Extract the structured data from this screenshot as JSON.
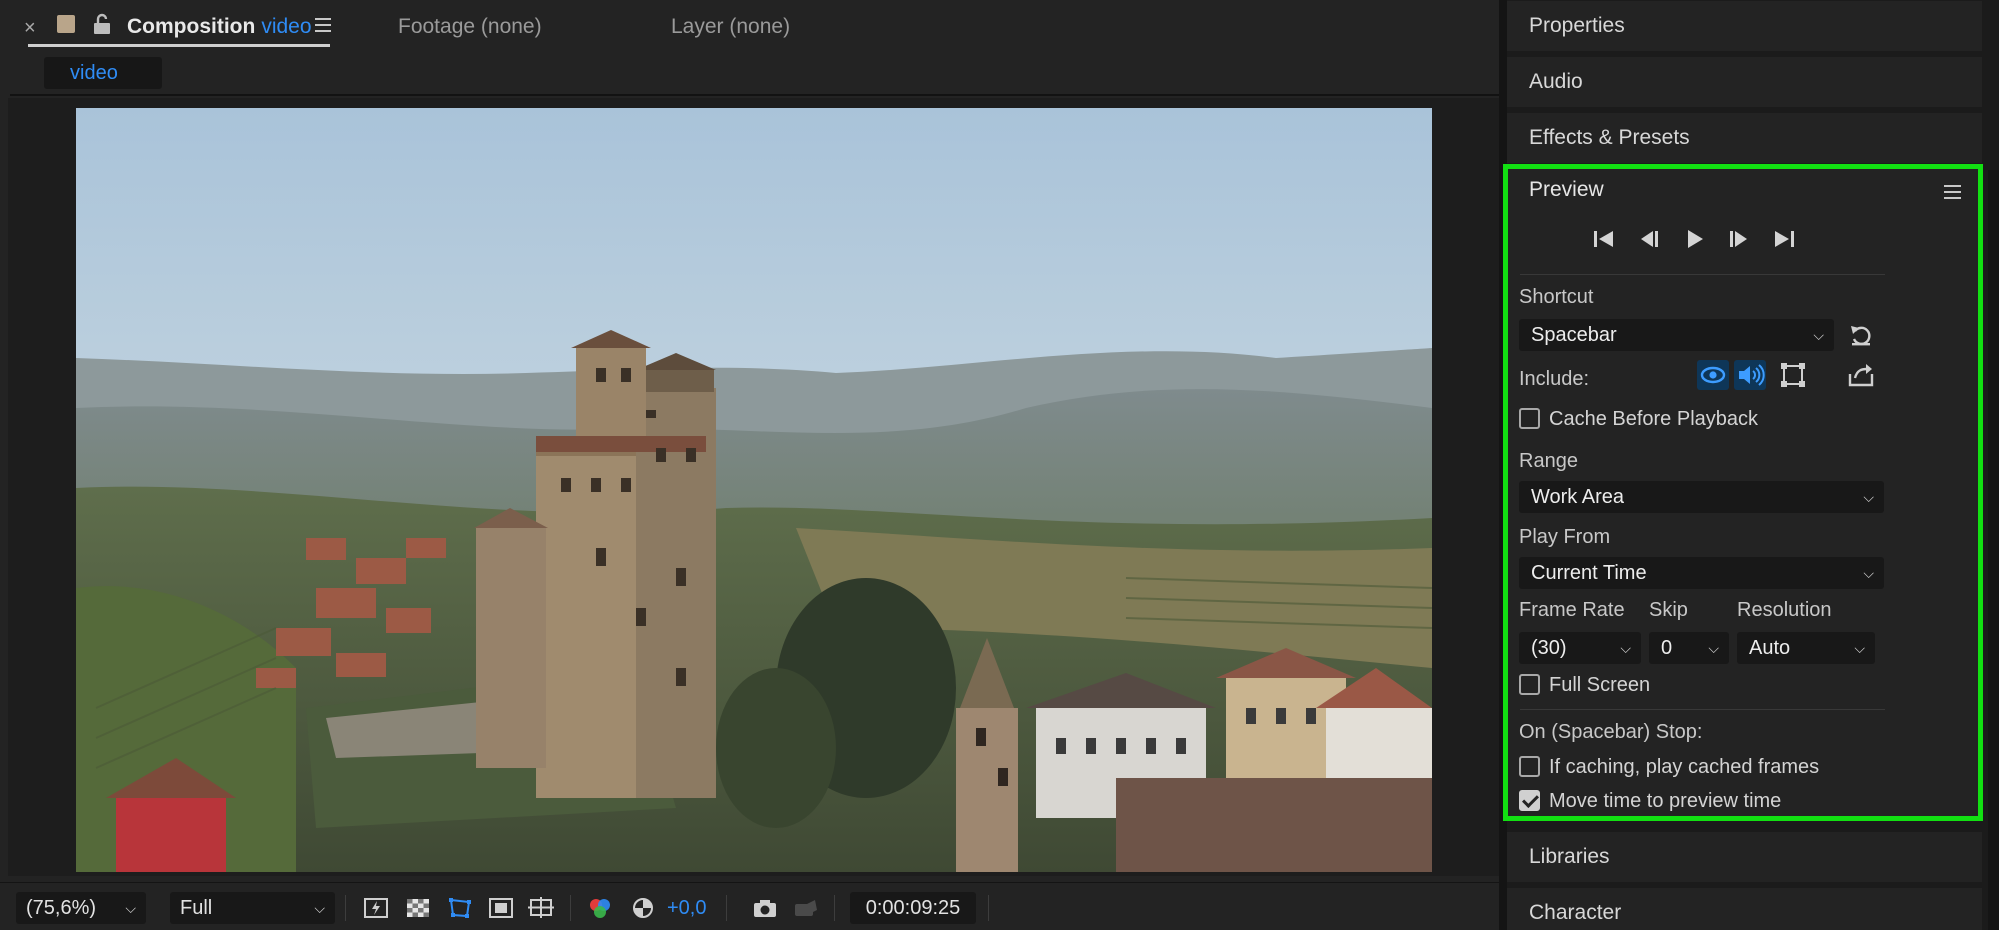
{
  "composition_panel": {
    "tabs": {
      "close_glyph": "×",
      "composition_label": "Composition",
      "composition_name": "video",
      "footage_label": "Footage (none)",
      "layer_label": "Layer (none)"
    },
    "subtab": "video",
    "footer": {
      "zoom": "(75,6%)",
      "resolution": "Full",
      "exposure": "+0,0",
      "timecode": "0:00:09:25",
      "icons": [
        "fast-previews-icon",
        "transparency-grid-icon",
        "mask-path-visibility-icon",
        "region-of-interest-icon",
        "safe-margins-icon",
        "channels-icon",
        "reset-exposure-icon",
        "snapshot-icon",
        "show-snapshot-icon"
      ]
    }
  },
  "right_panels": {
    "properties": "Properties",
    "audio": "Audio",
    "effects_presets": "Effects & Presets",
    "libraries": "Libraries",
    "character": "Character"
  },
  "preview": {
    "title": "Preview",
    "transport": [
      "first-frame-icon",
      "previous-frame-icon",
      "play-icon",
      "next-frame-icon",
      "last-frame-icon"
    ],
    "shortcut_label": "Shortcut",
    "shortcut_value": "Spacebar",
    "include_label": "Include:",
    "include_icons": [
      "video-eye-icon",
      "audio-speaker-icon",
      "overlays-icon",
      "export-icon"
    ],
    "cache_before_playback": {
      "label": "Cache Before Playback",
      "checked": false
    },
    "range_label": "Range",
    "range_value": "Work Area",
    "play_from_label": "Play From",
    "play_from_value": "Current Time",
    "frame_rate_label": "Frame Rate",
    "frame_rate_value": "(30)",
    "skip_label": "Skip",
    "skip_value": "0",
    "resolution_label": "Resolution",
    "resolution_value": "Auto",
    "full_screen": {
      "label": "Full Screen",
      "checked": false
    },
    "on_stop_label": "On (Spacebar) Stop:",
    "if_caching": {
      "label": "If caching, play cached frames",
      "checked": false
    },
    "move_time": {
      "label": "Move time to preview time",
      "checked": true
    }
  },
  "colors": {
    "accent_blue": "#2f8cf5",
    "highlight_green": "#12e012",
    "panel_bg": "#232323",
    "field_bg": "#181818"
  }
}
